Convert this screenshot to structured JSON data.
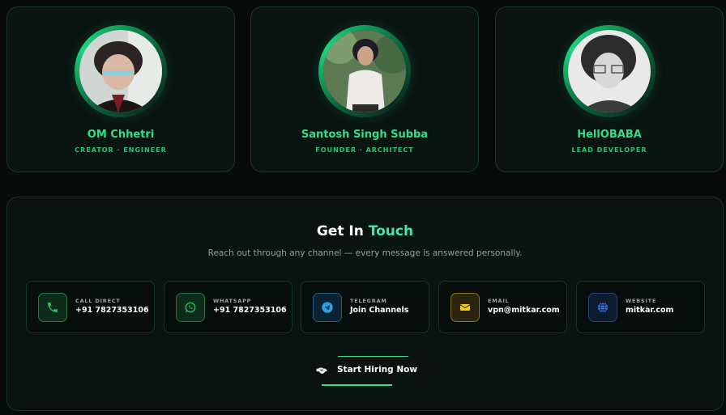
{
  "team": [
    {
      "name": "OM Chhetri",
      "role": "CREATOR · ENGINEER",
      "avatar": "portrait-photo"
    },
    {
      "name": "Santosh Singh Subba",
      "role": "FOUNDER · ARCHITECT",
      "avatar": "portrait-photo"
    },
    {
      "name": "HellOBABA",
      "role": "LEAD DEVELOPER",
      "avatar": "portrait-photo"
    }
  ],
  "contact": {
    "title_main": "Get In ",
    "title_accent": "Touch",
    "subtitle": "Reach out through any channel — every message is answered personally.",
    "channels": [
      {
        "label": "CALL DIRECT",
        "value": "+91 7827353106",
        "icon": "phone-icon",
        "color": "#22c55e"
      },
      {
        "label": "WHATSAPP",
        "value": "+91 7827353106",
        "icon": "whatsapp-icon",
        "color": "#22c55e"
      },
      {
        "label": "TELEGRAM",
        "value": "Join Channels",
        "icon": "telegram-icon",
        "color": "#2ba0e0"
      },
      {
        "label": "EMAIL",
        "value": "vpn@mitkar.com",
        "icon": "mail-icon",
        "color": "#facc15"
      },
      {
        "label": "WEBSITE",
        "value": "mitkar.com",
        "icon": "globe-icon",
        "color": "#3b82f6"
      }
    ],
    "cta_label": "Start Hiring Now",
    "cta_icon": "handshake-icon"
  },
  "colors": {
    "accent_green": "#2fe08a",
    "accent_teal": "#40e6b0",
    "background": "#070b0a"
  }
}
